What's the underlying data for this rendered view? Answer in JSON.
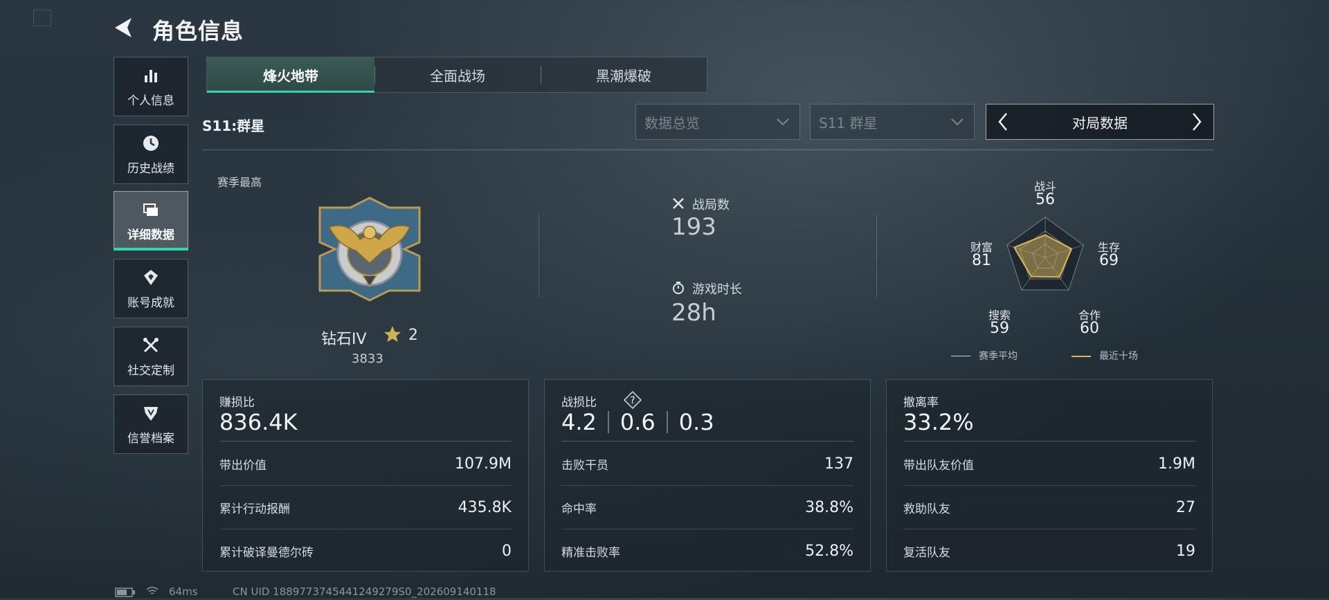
{
  "header": {
    "title": "角色信息"
  },
  "sidebar": {
    "items": [
      {
        "label": "个人信息",
        "icon": "bar-chart-icon"
      },
      {
        "label": "历史战绩",
        "icon": "clock-icon"
      },
      {
        "label": "详细数据",
        "icon": "cards-icon",
        "active": true
      },
      {
        "label": "账号成就",
        "icon": "achievement-icon"
      },
      {
        "label": "社交定制",
        "icon": "tools-icon"
      },
      {
        "label": "信誉档案",
        "icon": "shield-icon"
      }
    ]
  },
  "tabs": [
    {
      "label": "烽火地带",
      "active": true
    },
    {
      "label": "全面战场",
      "active": false
    },
    {
      "label": "黑潮爆破",
      "active": false
    }
  ],
  "season": {
    "title": "S11:群星"
  },
  "filters": {
    "data_type": "数据总览",
    "season": "S11 群星",
    "match_selector": "对局数据"
  },
  "rank": {
    "section_label": "赛季最高",
    "name": "钻石IV",
    "stars": "2",
    "score": "3833"
  },
  "overview": {
    "matches_label": "战局数",
    "matches_value": "193",
    "playtime_label": "游戏时长",
    "playtime_value": "28h"
  },
  "radar": {
    "axes": [
      {
        "label": "战斗",
        "value": "56"
      },
      {
        "label": "生存",
        "value": "69"
      },
      {
        "label": "合作",
        "value": "60"
      },
      {
        "label": "搜索",
        "value": "59"
      },
      {
        "label": "财富",
        "value": "81"
      }
    ],
    "recent_values": [
      56,
      69,
      60,
      59,
      81
    ],
    "legend_avg": "赛季平均",
    "legend_recent": "最近十场",
    "colors": {
      "avg": "#d0d4d7",
      "recent": "#d8b85a"
    }
  },
  "cards": {
    "profit": {
      "label": "赚损比",
      "value": "836.4K",
      "rows": [
        {
          "label": "带出价值",
          "value": "107.9M"
        },
        {
          "label": "累计行动报酬",
          "value": "435.8K"
        },
        {
          "label": "累计破译曼德尔砖",
          "value": "0"
        }
      ]
    },
    "combat": {
      "label": "战损比",
      "values": [
        "4.2",
        "0.6",
        "0.3"
      ],
      "rows": [
        {
          "label": "击败干员",
          "value": "137"
        },
        {
          "label": "命中率",
          "value": "38.8%"
        },
        {
          "label": "精准击败率",
          "value": "52.8%"
        }
      ]
    },
    "extract": {
      "label": "撤离率",
      "value": "33.2%",
      "rows": [
        {
          "label": "带出队友价值",
          "value": "1.9M"
        },
        {
          "label": "救助队友",
          "value": "27"
        },
        {
          "label": "复活队友",
          "value": "19"
        }
      ]
    }
  },
  "footer": {
    "ping": "64ms",
    "uid": "CN UID 1889773745441249279S0_202609140118"
  },
  "accent_color": "#39d2ae"
}
